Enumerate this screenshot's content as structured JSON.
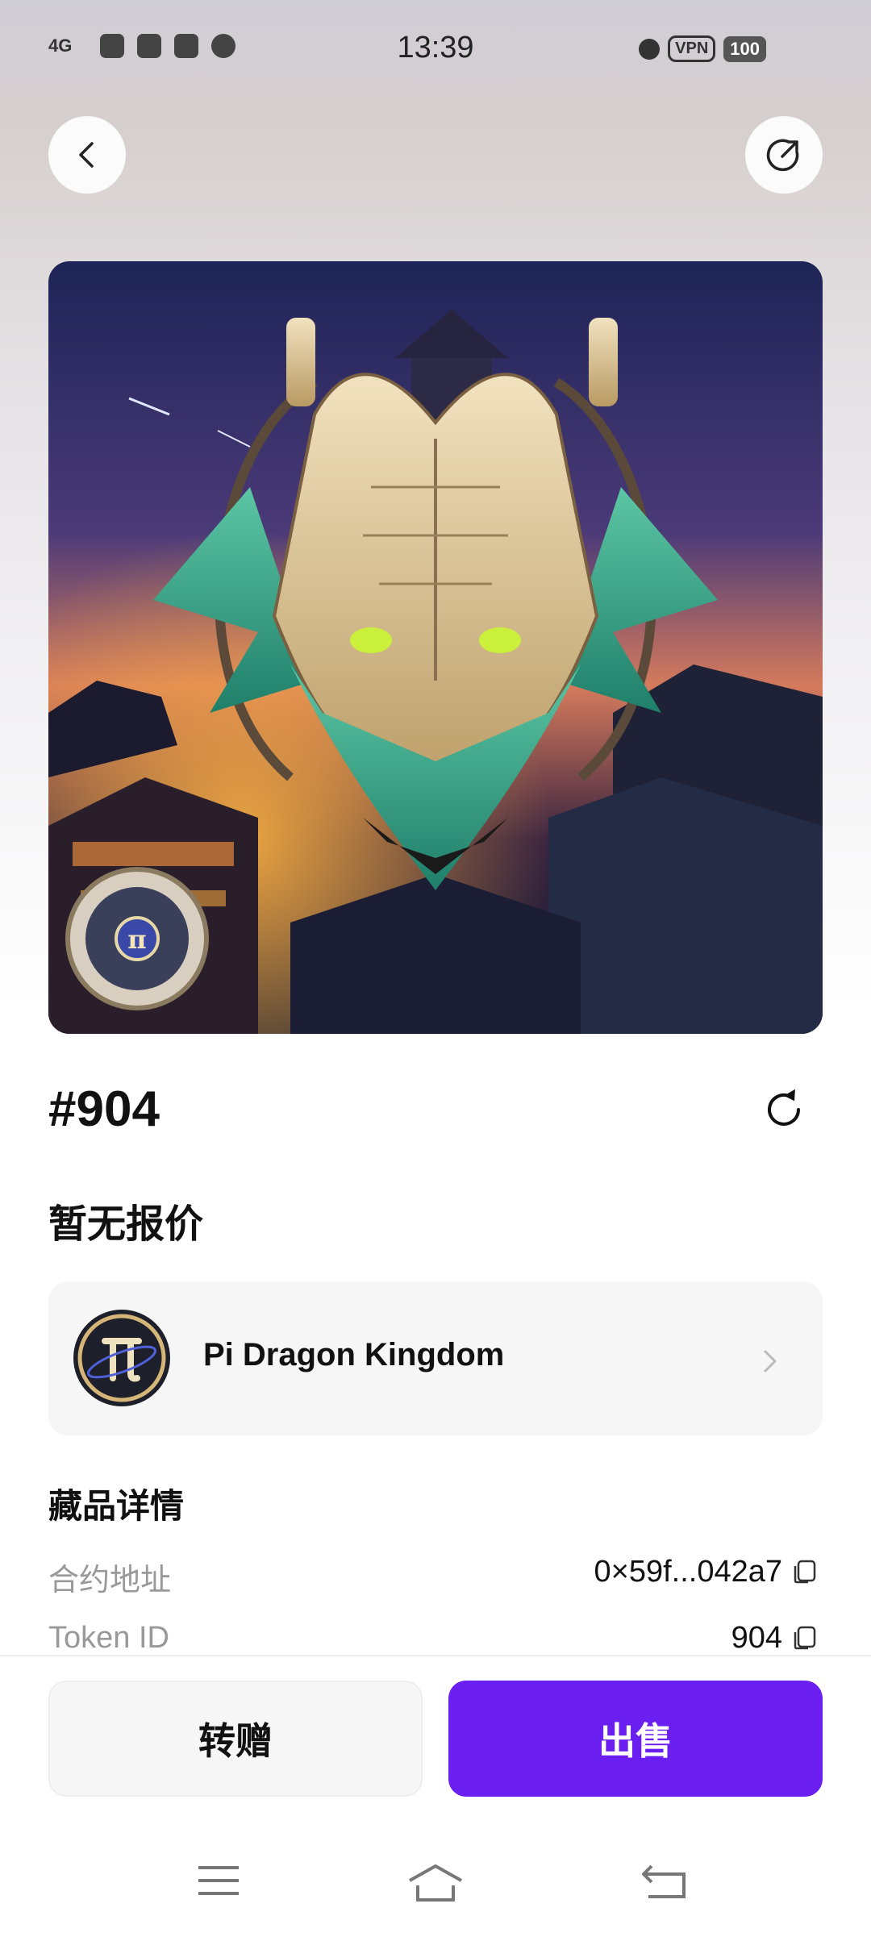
{
  "status_bar": {
    "network": "4G",
    "time": "13:39",
    "vpn": "VPN",
    "battery": "100"
  },
  "hero": {
    "badge_letter": "π"
  },
  "nft": {
    "title": "#904",
    "price_status": "暂无报价"
  },
  "collection": {
    "name": "Pi Dragon Kingdom"
  },
  "details": {
    "section_title": "藏品详情",
    "rows": [
      {
        "label": "合约地址",
        "value": "0×59f...042a7"
      },
      {
        "label": "Token ID",
        "value": "904"
      }
    ]
  },
  "actions": {
    "gift_label": "转赠",
    "sell_label": "出售"
  },
  "colors": {
    "accent": "#6b1ef0",
    "card": "#f6f6f6"
  },
  "icons": [
    "back-icon",
    "share-icon",
    "refresh-icon",
    "chevron-right-icon",
    "copy-icon",
    "menu-icon",
    "home-icon",
    "back-nav-icon"
  ]
}
